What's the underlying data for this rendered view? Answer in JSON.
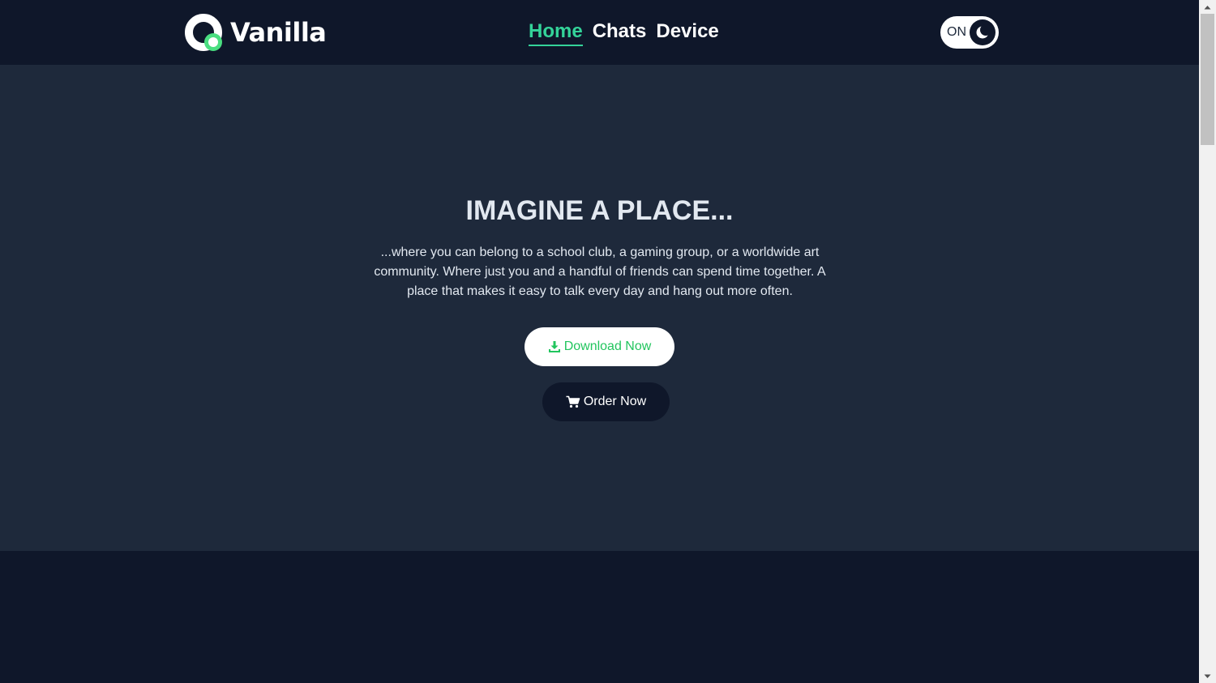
{
  "header": {
    "logo_text": "Vanilla",
    "nav": [
      {
        "label": "Home",
        "active": true
      },
      {
        "label": "Chats",
        "active": false
      },
      {
        "label": "Device",
        "active": false
      }
    ],
    "theme_toggle_label": "ON"
  },
  "hero": {
    "title": "IMAGINE A PLACE...",
    "text": "...where you can belong to a school club, a gaming group, or a worldwide art community. Where just you and a handful of friends can spend time together. A place that makes it easy to talk every day and hang out more often.",
    "download_label": "Download Now",
    "order_label": "Order Now"
  },
  "icons": {
    "download": "download-icon",
    "cart": "cart-icon",
    "theme": "moon-icon"
  },
  "colors": {
    "accent": "#34d399",
    "header_bg": "#0f172a",
    "hero_bg": "#1e293b",
    "download_text": "#22c55e"
  }
}
